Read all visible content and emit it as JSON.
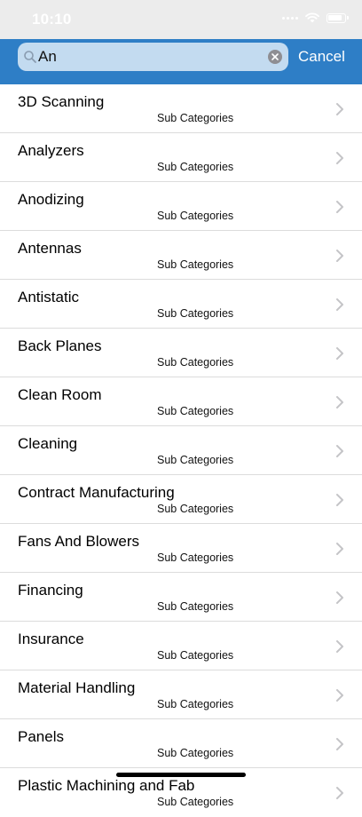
{
  "status": {
    "time": "10:10"
  },
  "search": {
    "value": "An",
    "cancel_label": "Cancel"
  },
  "subtitle": "Sub Categories",
  "items": [
    {
      "title": "3D Scanning"
    },
    {
      "title": "Analyzers"
    },
    {
      "title": "Anodizing"
    },
    {
      "title": "Antennas"
    },
    {
      "title": "Antistatic"
    },
    {
      "title": "Back Planes"
    },
    {
      "title": "Clean Room"
    },
    {
      "title": "Cleaning"
    },
    {
      "title": "Contract Manufacturing"
    },
    {
      "title": "Fans And Blowers"
    },
    {
      "title": "Financing"
    },
    {
      "title": "Insurance"
    },
    {
      "title": "Material Handling"
    },
    {
      "title": "Panels"
    },
    {
      "title": "Plastic Machining and Fab"
    }
  ],
  "colors": {
    "accent": "#2e7ec6",
    "field": "#c3dbf0",
    "separator": "#dcdcdc",
    "chevron": "#c4c4c7"
  }
}
